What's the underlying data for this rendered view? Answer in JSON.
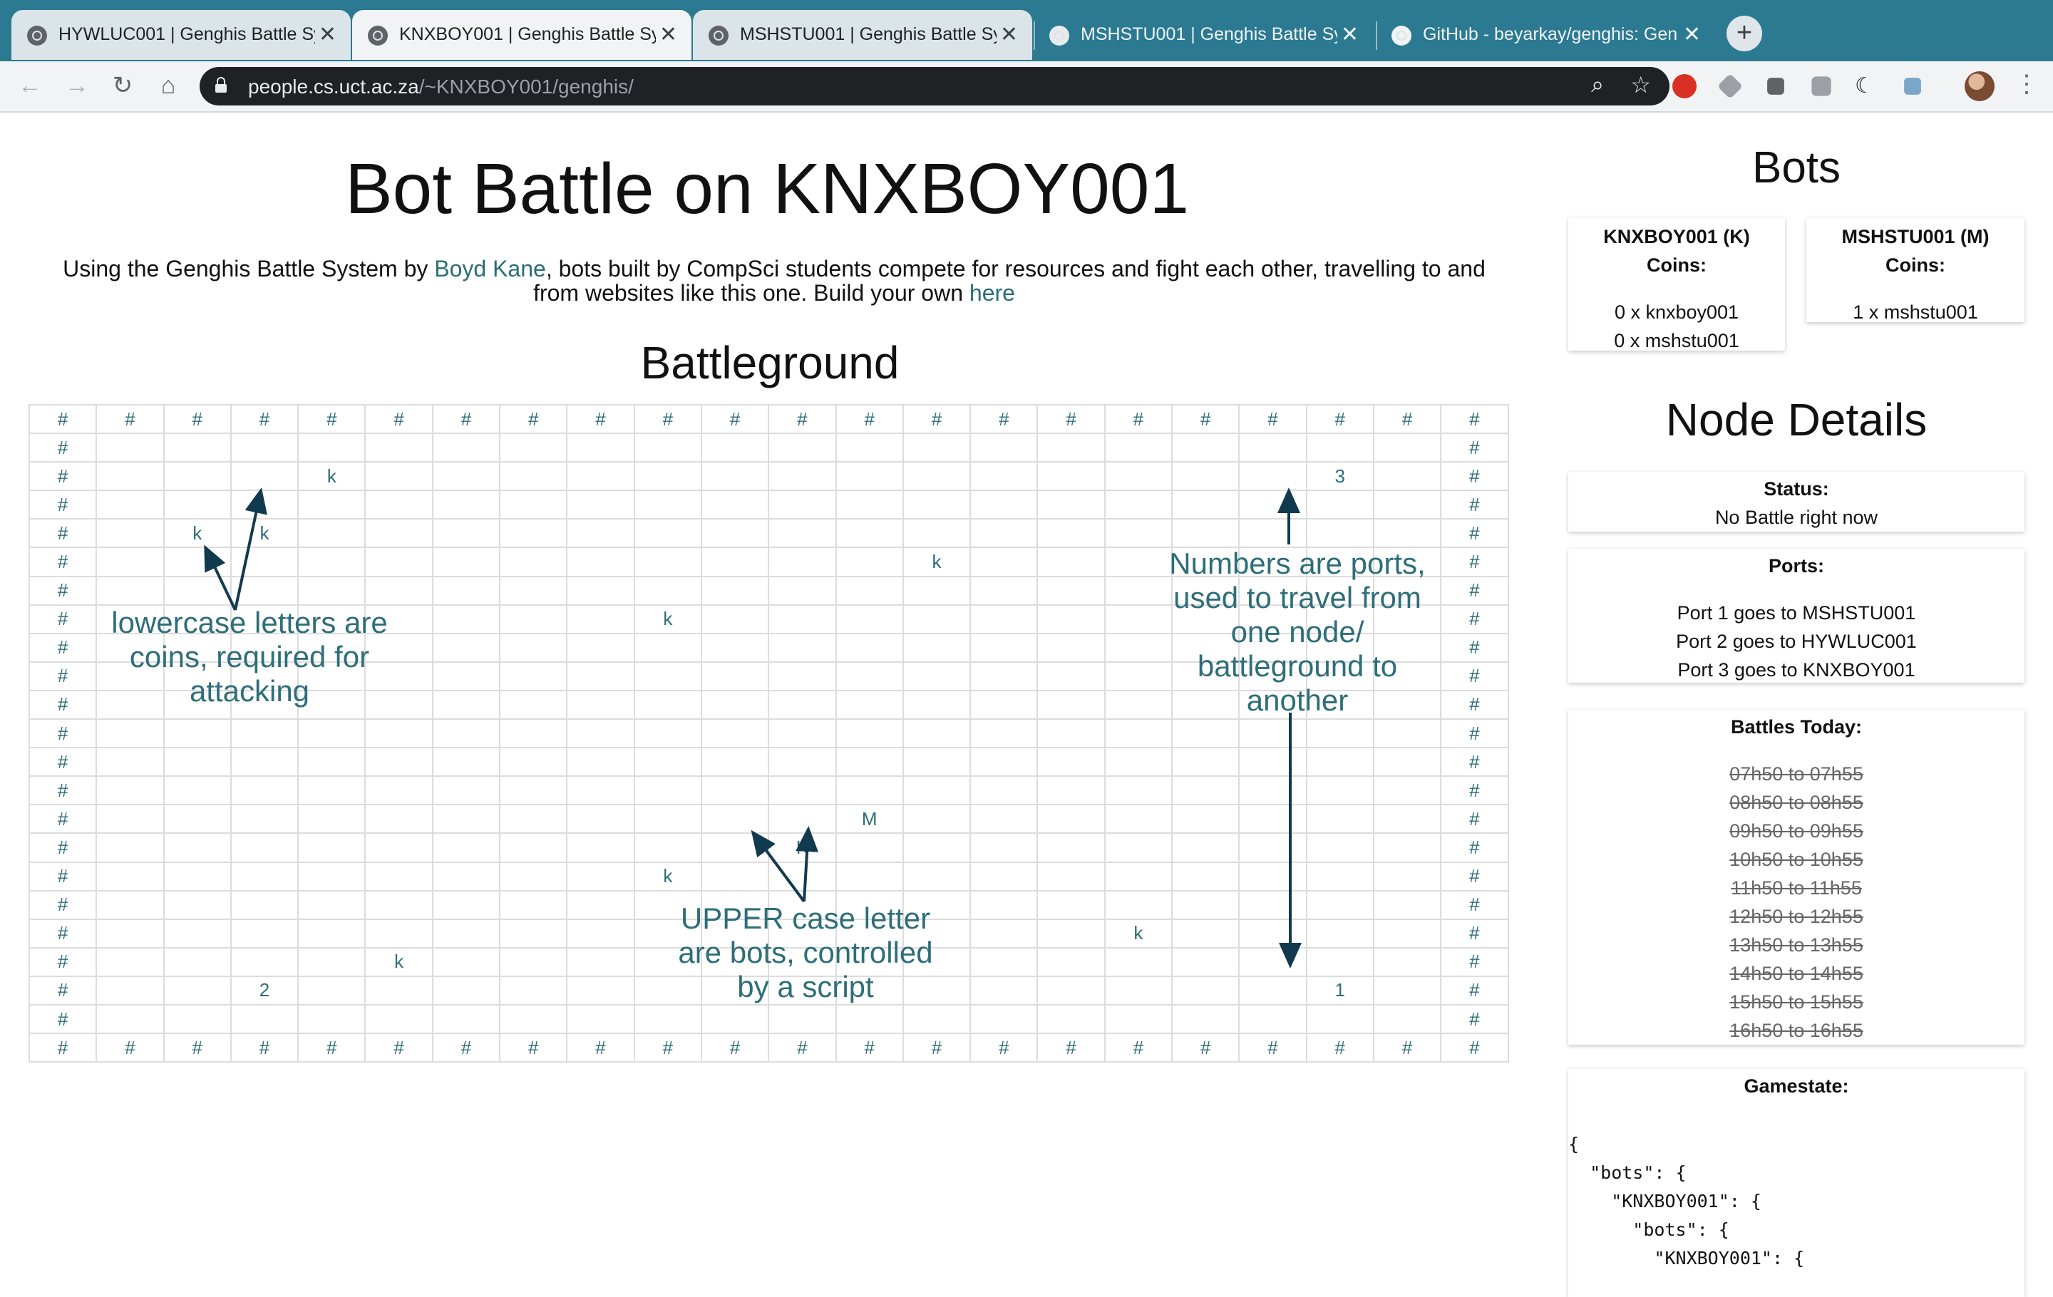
{
  "browser": {
    "tabs": [
      {
        "title": "HYWLUC001 | Genghis Battle Sy",
        "active": false
      },
      {
        "title": "KNXBOY001 | Genghis Battle Sy",
        "active": true
      },
      {
        "title": "MSHSTU001 | Genghis Battle Sy",
        "active": false
      },
      {
        "title": "MSHSTU001 | Genghis Battle Sy",
        "active": false
      },
      {
        "title": "GitHub - beyarkay/genghis: Gen",
        "active": false
      }
    ],
    "new_tab_label": "+",
    "close_glyph": "✕",
    "url_host": "people.cs.uct.ac.za",
    "url_path": "/~KNXBOY001/genghis/",
    "icons": [
      "back-icon",
      "forward-icon",
      "reload-icon",
      "home-icon",
      "lock-icon",
      "zoom-icon",
      "star-icon",
      "menu-icon"
    ]
  },
  "page": {
    "title": "Bot Battle on KNXBOY001",
    "intro_before": "Using the Genghis Battle System by ",
    "intro_link1": "Boyd Kane",
    "intro_middle": ", bots built by CompSci students compete for resources and fight each other, travelling to and from websites like this one. Build your own ",
    "intro_link2": "here",
    "battleground_heading": "Battleground"
  },
  "grid": [
    "######################",
    "#                    #",
    "#   k              3 #",
    "#                    #",
    "# kk                 #",
    "#            k       #",
    "#                    #",
    "#        k           #",
    "#                    #",
    "#                    #",
    "#                    #",
    "#                    #",
    "#                    #",
    "#                    #",
    "#           M        #",
    "#          K         #",
    "#        k           #",
    "#                    #",
    "#               k    #",
    "#    k               #",
    "#  2               1 #",
    "#                    #",
    "######################"
  ],
  "annotations": {
    "coins": [
      "lowercase letters are",
      "coins, required for",
      "attacking"
    ],
    "ports": [
      "Numbers are ports,",
      "used to travel from",
      "one node/",
      "battleground to",
      "another"
    ],
    "bots": [
      "UPPER case letter",
      "are bots, controlled",
      "by a script"
    ]
  },
  "sidebar": {
    "bots_heading": "Bots",
    "bots": [
      {
        "name": "KNXBOY001 (K)",
        "coins_label": "Coins:",
        "coins": [
          "0 x knxboy001",
          "0 x mshstu001"
        ]
      },
      {
        "name": "MSHSTU001 (M)",
        "coins_label": "Coins:",
        "coins": [
          "1 x mshstu001"
        ]
      }
    ],
    "node_heading": "Node Details",
    "status_label": "Status:",
    "status_value": "No Battle right now",
    "ports_label": "Ports:",
    "ports": [
      "Port 1 goes to MSHSTU001",
      "Port 2 goes to HYWLUC001",
      "Port 3 goes to KNXBOY001"
    ],
    "battles_label": "Battles Today:",
    "battles": [
      "07h50 to 07h55",
      "08h50 to 08h55",
      "09h50 to 09h55",
      "10h50 to 10h55",
      "11h50 to 11h55",
      "12h50 to 12h55",
      "13h50 to 13h55",
      "14h50 to 14h55",
      "15h50 to 15h55",
      "16h50 to 16h55"
    ],
    "gamestate_label": "Gamestate:",
    "gamestate_lines": [
      "{",
      "  \"bots\": {",
      "    \"KNXBOY001\": {",
      "      \"bots\": {",
      "        \"KNXBOY001\": {"
    ]
  },
  "colors": {
    "tabbar": "#2c7a92",
    "accent_text": "#2d6e79",
    "link": "#2a6e75",
    "arrow": "#123a4e"
  }
}
